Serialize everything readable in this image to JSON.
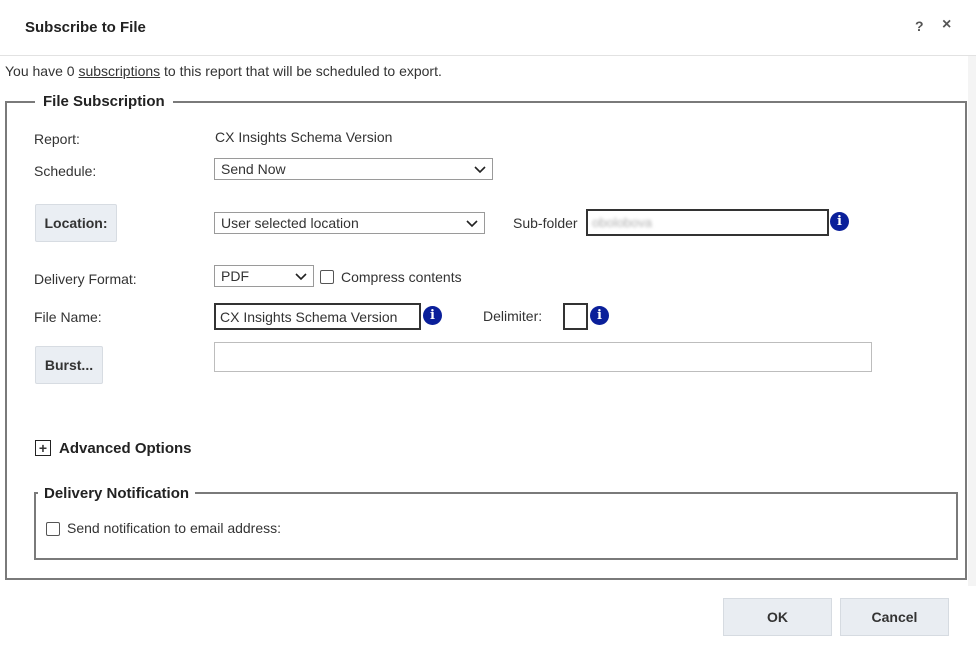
{
  "dialog": {
    "title": "Subscribe to File",
    "help_label": "?",
    "close_label": "×"
  },
  "info": {
    "prefix": "You have 0 ",
    "link": "subscriptions",
    "suffix": " to this report that will be scheduled to export."
  },
  "file_subscription": {
    "legend": "File Subscription",
    "report_label": "Report:",
    "report_value": "CX Insights Schema Version",
    "schedule_label": "Schedule:",
    "schedule_value": "Send Now",
    "location_button": "Location:",
    "location_value": "User selected location",
    "subfolder_label": "Sub-folder",
    "subfolder_value": "obolobova",
    "delivery_format_label": "Delivery Format:",
    "delivery_format_value": "PDF",
    "compress_label": "Compress contents",
    "file_name_label": "File Name:",
    "file_name_value": "CX Insights Schema Version",
    "delimiter_label": "Delimiter:",
    "delimiter_value": "",
    "burst_button": "Burst...",
    "burst_value": "",
    "advanced_label": "Advanced Options",
    "expand_symbol": "+"
  },
  "delivery_notification": {
    "legend": "Delivery Notification",
    "email_label": "Send notification to email address:"
  },
  "footer": {
    "ok_label": "OK",
    "cancel_label": "Cancel"
  },
  "icons": {
    "info": "i"
  },
  "colors": {
    "info_icon": "#0a1f9a",
    "button_bg": "#eaeef3",
    "fieldset_border": "#7a7a7a"
  }
}
